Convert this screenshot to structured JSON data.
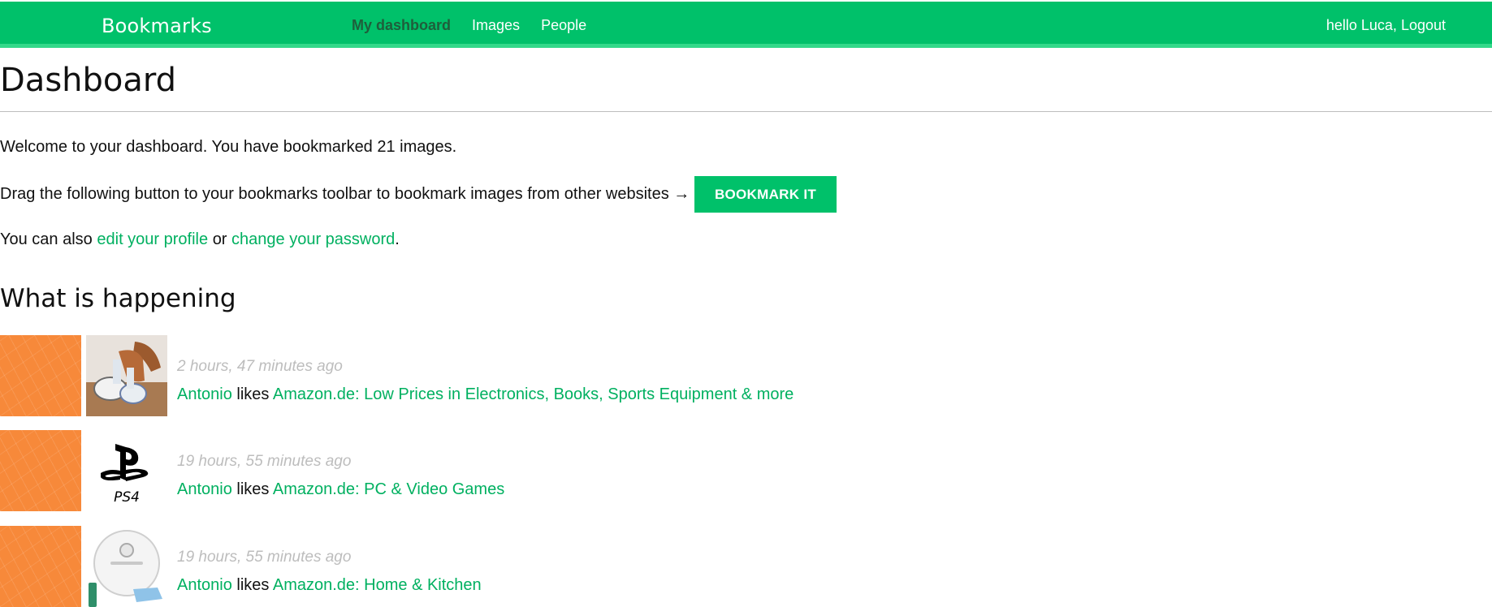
{
  "header": {
    "brand": "Bookmarks",
    "nav": [
      {
        "label": "My dashboard",
        "active": true
      },
      {
        "label": "Images",
        "active": false
      },
      {
        "label": "People",
        "active": false
      }
    ],
    "greeting": "hello Luca,",
    "logout": "Logout"
  },
  "colors": {
    "accent": "#00c16a",
    "link": "#00b060",
    "avatar": "#f7893a"
  },
  "page": {
    "title": "Dashboard",
    "welcome": "Welcome to your dashboard. You have bookmarked 21 images.",
    "drag_text": "Drag the following button to your bookmarks toolbar to bookmark images from other websites →",
    "bookmark_button": "BOOKMARK IT",
    "also_prefix": "You can also",
    "edit_profile": "edit your profile",
    "also_or": "or",
    "change_password": "change your password",
    "also_suffix": ".",
    "activity_title": "What is happening"
  },
  "activity": [
    {
      "time": "2 hours, 47 minutes ago",
      "user": "Antonio",
      "verb": "likes",
      "target": "Amazon.de: Low Prices in Electronics, Books, Sports Equipment & more",
      "thumb": "sneakers-photo-icon"
    },
    {
      "time": "19 hours, 55 minutes ago",
      "user": "Antonio",
      "verb": "likes",
      "target": "Amazon.de: PC & Video Games",
      "thumb": "ps4-logo-icon"
    },
    {
      "time": "19 hours, 55 minutes ago",
      "user": "Antonio",
      "verb": "likes",
      "target": "Amazon.de: Home & Kitchen",
      "thumb": "robot-vacuum-icon"
    }
  ]
}
